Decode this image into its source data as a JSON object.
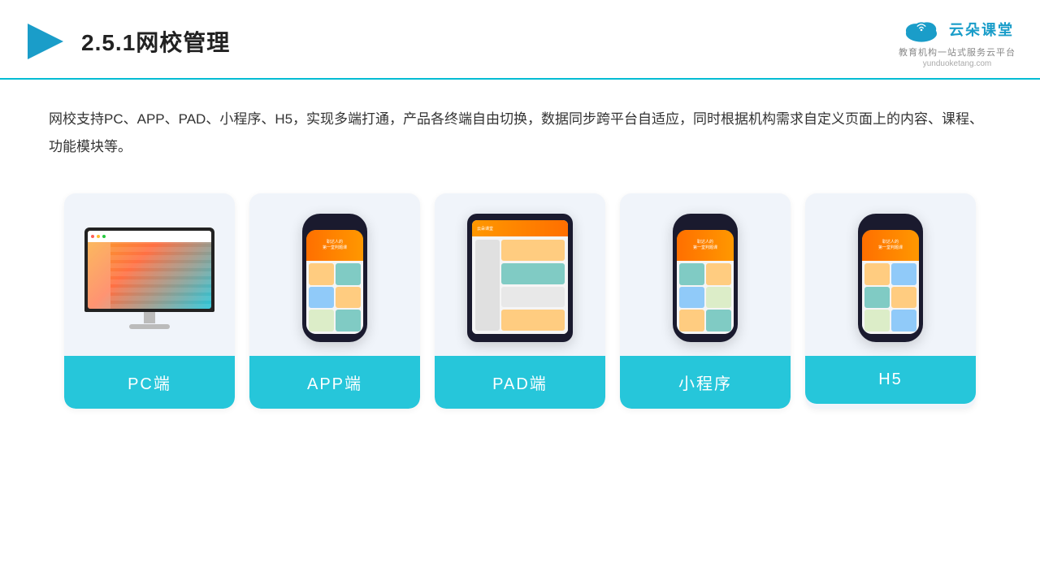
{
  "header": {
    "title": "2.5.1网校管理",
    "logo_text": "云朵课堂",
    "logo_sub": "教育机构一站式服务云平台",
    "logo_url": "yunduoketang.com"
  },
  "description": {
    "text": "网校支持PC、APP、PAD、小程序、H5，实现多端打通，产品各终端自由切换，数据同步跨平台自适应，同时根据机构需求自定义页面上的内容、课程、功能模块等。"
  },
  "cards": [
    {
      "id": "pc",
      "label": "PC端"
    },
    {
      "id": "app",
      "label": "APP端"
    },
    {
      "id": "pad",
      "label": "PAD端"
    },
    {
      "id": "miniapp",
      "label": "小程序"
    },
    {
      "id": "h5",
      "label": "H5"
    }
  ]
}
